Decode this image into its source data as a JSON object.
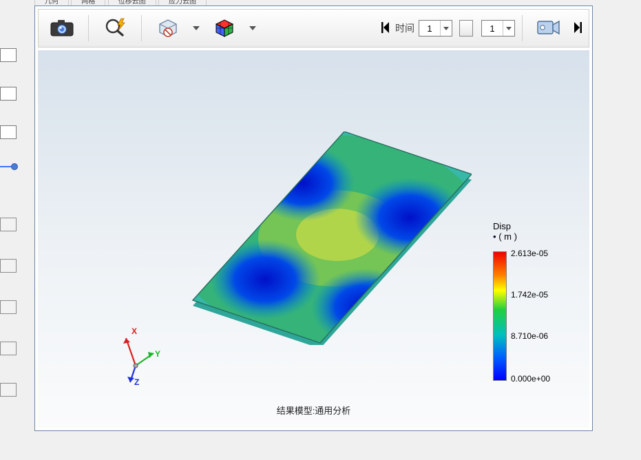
{
  "tabs": [
    "几何",
    "网格",
    "位移云图",
    "应力云图"
  ],
  "toolbar": {
    "time_label": "时间",
    "time_value": "1",
    "step_value": "1"
  },
  "viewer": {
    "result_title": "结果模型:通用分析"
  },
  "triad": {
    "x": "X",
    "y": "Y",
    "z": "Z"
  },
  "legend": {
    "title_line1": "Disp",
    "title_line2": "( m )",
    "ticks": [
      "2.613e-05",
      "1.742e-05",
      "8.710e-06",
      "0.000e+00"
    ]
  }
}
